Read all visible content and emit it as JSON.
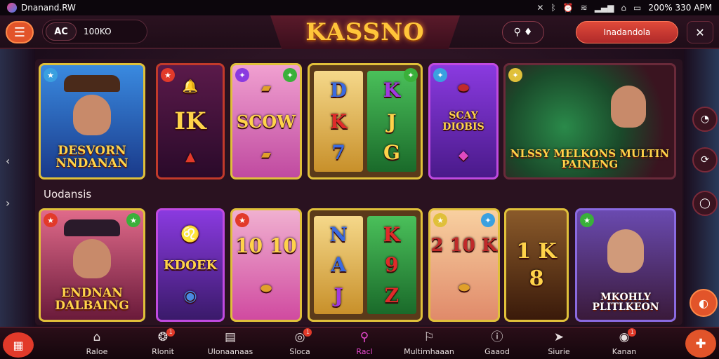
{
  "status": {
    "app_title": "Dnanand.RW",
    "right_text": "200% 330 APM",
    "icons": [
      "close-icon",
      "bluetooth-icon",
      "alarm-icon",
      "wifi-icon",
      "signal-icon",
      "screenshot-icon",
      "battery-icon"
    ]
  },
  "header": {
    "logo": "KASSNO",
    "user_initials": "AC",
    "balance": "100KO",
    "cta_label": "Inadandola",
    "menu_icon": "hamburger-icon",
    "search_icon": "search-icon",
    "tools_icon": "tools-icon"
  },
  "section": {
    "label": "Uodansis"
  },
  "row1": [
    {
      "title": "DESVORN NNDANAN",
      "style": "portrait"
    },
    {
      "title": "IK",
      "style": "symbols"
    },
    {
      "title": "SCOW",
      "style": "pink"
    },
    {
      "reels": [
        [
          "D",
          "K",
          "7"
        ],
        [
          "K",
          "J",
          "G"
        ]
      ],
      "style": "reels"
    },
    {
      "title": "SCAY DIOBIS",
      "style": "purple"
    },
    {
      "title": "NLSSY MELKONS MULTIN PAINENG",
      "style": "roulette"
    }
  ],
  "row2": [
    {
      "title": "ENDNAN DALBAING",
      "style": "portrait"
    },
    {
      "title": "KDOEK",
      "style": "purple"
    },
    {
      "title": "10 10",
      "style": "pink"
    },
    {
      "reels": [
        [
          "N",
          "A",
          "J"
        ],
        [
          "K",
          "9",
          "Z"
        ]
      ],
      "style": "reels"
    },
    {
      "title": "2 10 K",
      "style": "numbers"
    },
    {
      "title": "1 K 8",
      "style": "dark"
    },
    {
      "title": "MKOHLY PLITLKEON",
      "style": "portrait2"
    }
  ],
  "nav": [
    {
      "label": "Raloe",
      "icon": "home-icon"
    },
    {
      "label": "Rlonit",
      "icon": "chip-icon",
      "badge": "1"
    },
    {
      "label": "Ulonaanaas",
      "icon": "calendar-icon"
    },
    {
      "label": "Sloca",
      "icon": "spin-icon",
      "badge": "1"
    },
    {
      "label": "Racl",
      "icon": "search-icon",
      "active": true
    },
    {
      "label": "Multimhaaan",
      "icon": "chat-icon"
    },
    {
      "label": "Gaaod",
      "icon": "info-icon"
    },
    {
      "label": "Siurie",
      "icon": "send-icon"
    },
    {
      "label": "Kanan",
      "icon": "target-icon",
      "badge": "1"
    }
  ],
  "colors": {
    "accent": "#e2542a",
    "logo": "#ffc53a",
    "active_nav": "#e84ad0"
  }
}
